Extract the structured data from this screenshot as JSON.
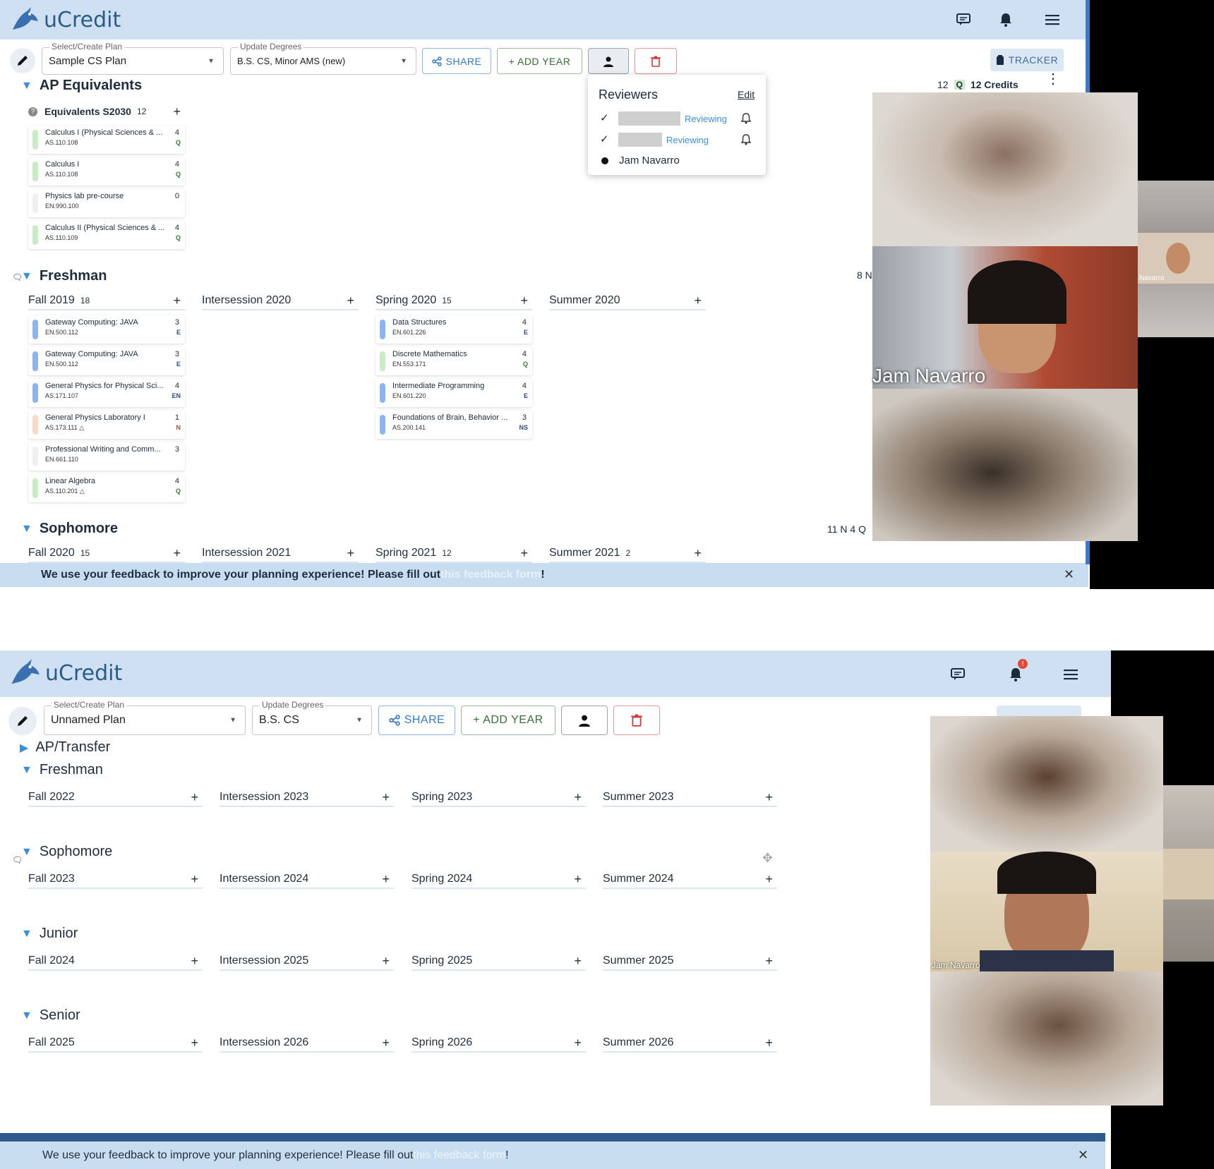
{
  "screen1": {
    "app_name": "uCredit",
    "plan_select": {
      "label": "Select/Create Plan",
      "value": "Sample CS Plan"
    },
    "degree_select": {
      "label": "Update Degrees",
      "value": "B.S. CS, Minor AMS (new)"
    },
    "buttons": {
      "share": "SHARE",
      "add_year": "+ ADD YEAR",
      "tracker": "TRACKER"
    },
    "summary": {
      "q_count": "12",
      "q_tag": "Q",
      "credits": "12 Credits"
    },
    "reviewers": {
      "title": "Reviewers",
      "edit": "Edit",
      "rows": [
        {
          "status": "Reviewing"
        },
        {
          "status": "Reviewing"
        },
        {
          "name": "Jam Navarro"
        }
      ]
    },
    "ap": {
      "title": "AP Equivalents",
      "group": "Equivalents S2030",
      "group_credits": "12",
      "courses": [
        {
          "title": "Calculus I (Physical Sciences & ...",
          "num": "AS.110.108",
          "credits": "4",
          "area": "Q",
          "color": "#c9ecc4"
        },
        {
          "title": "Calculus I",
          "num": "AS.110.108",
          "credits": "4",
          "area": "Q",
          "color": "#c9ecc4"
        },
        {
          "title": "Physics lab pre-course",
          "num": "EN.990.100",
          "credits": "0",
          "area": "",
          "color": "#f0f0f0"
        },
        {
          "title": "Calculus II (Physical Sciences & ...",
          "num": "AS.110.109",
          "credits": "4",
          "area": "Q",
          "color": "#c9ecc4"
        }
      ]
    },
    "freshman": {
      "title": "Freshman",
      "right_tag": "8 N",
      "semesters": [
        {
          "name": "Fall 2019",
          "credits": "18"
        },
        {
          "name": "Intersession 2020",
          "credits": ""
        },
        {
          "name": "Spring 2020",
          "credits": "15"
        },
        {
          "name": "Summer 2020",
          "credits": ""
        }
      ],
      "fall_courses": [
        {
          "title": "Gateway Computing: JAVA",
          "num": "EN.500.112",
          "credits": "3",
          "area": "E",
          "color": "#8bb4f0"
        },
        {
          "title": "Gateway Computing: JAVA",
          "num": "EN.500.112",
          "credits": "3",
          "area": "E",
          "color": "#8bb4f0"
        },
        {
          "title": "General Physics for Physical Sci...",
          "num": "AS.171.107",
          "credits": "4",
          "area": "EN",
          "color": "#8bb4f0"
        },
        {
          "title": "General Physics Laboratory I",
          "num": "AS.173.111 △",
          "credits": "1",
          "area": "N",
          "color": "#f8dac6"
        },
        {
          "title": "Professional Writing and Comm...",
          "num": "EN.661.110",
          "credits": "3",
          "area": "",
          "color": "#f0f0f0"
        },
        {
          "title": "Linear Algebra",
          "num": "AS.110.201 △",
          "credits": "4",
          "area": "Q",
          "color": "#c9ecc4"
        }
      ],
      "spring_courses": [
        {
          "title": "Data Structures",
          "num": "EN.601.226",
          "credits": "4",
          "area": "E",
          "color": "#8bb4f0"
        },
        {
          "title": "Discrete Mathematics",
          "num": "EN.553.171",
          "credits": "4",
          "area": "Q",
          "color": "#c9ecc4"
        },
        {
          "title": "Intermediate Programming",
          "num": "EN.601.220",
          "credits": "4",
          "area": "E",
          "color": "#8bb4f0"
        },
        {
          "title": "Foundations of Brain, Behavior ...",
          "num": "AS.200.141",
          "credits": "3",
          "area": "NS",
          "color": "#8bb4f0"
        }
      ]
    },
    "sophomore": {
      "title": "Sophomore",
      "right_tags": "11 N  4 Q",
      "semesters": [
        {
          "name": "Fall 2020",
          "credits": "15"
        },
        {
          "name": "Intersession 2021",
          "credits": ""
        },
        {
          "name": "Spring 2021",
          "credits": "12"
        },
        {
          "name": "Summer 2021",
          "credits": "2"
        }
      ]
    },
    "banner": {
      "text": "We use your feedback to improve your planning experience! Please fill out ",
      "link": "this feedback form",
      "end": "!"
    },
    "video_name": "Jam Navarro",
    "video_small_name": "Navarro"
  },
  "screen2": {
    "app_name": "uCredit",
    "plan_select": {
      "label": "Select/Create Plan",
      "value": "Unnamed Plan"
    },
    "degree_select": {
      "label": "Update Degrees",
      "value": "B.S. CS"
    },
    "buttons": {
      "share": "SHARE",
      "add_year": "+ ADD YEAR"
    },
    "ap_title": "AP/Transfer",
    "years": [
      {
        "title": "Freshman",
        "semesters": [
          "Fall 2022",
          "Intersession 2023",
          "Spring 2023",
          "Summer 2023"
        ]
      },
      {
        "title": "Sophomore",
        "semesters": [
          "Fall 2023",
          "Intersession 2024",
          "Spring 2024",
          "Summer 2024"
        ]
      },
      {
        "title": "Junior",
        "semesters": [
          "Fall 2024",
          "Intersession 2025",
          "Spring 2025",
          "Summer 2025"
        ]
      },
      {
        "title": "Senior",
        "semesters": [
          "Fall 2025",
          "Intersession 2026",
          "Spring 2026",
          "Summer 2026"
        ]
      }
    ],
    "notification_badge": "!",
    "banner": {
      "text": "We use your feedback to improve your planning experience! Please fill out ",
      "link": "this feedback form",
      "end": "!"
    },
    "video_name": "Jam Navarro"
  },
  "icons": {
    "logo": "blue-jay-logo-icon",
    "chat": "comment-icon",
    "bell": "bell-icon",
    "menu": "hamburger-menu-icon",
    "pencil": "pencil-icon",
    "share": "share-icon",
    "person": "person-icon",
    "trash": "trash-icon",
    "clipboard": "clipboard-icon",
    "close": "close-icon"
  },
  "colors": {
    "header_bg": "#cfe0f2",
    "accent_blue": "#3c8ed8",
    "banner_bg": "#c9ddf0",
    "delete_red": "#d23a3a"
  }
}
